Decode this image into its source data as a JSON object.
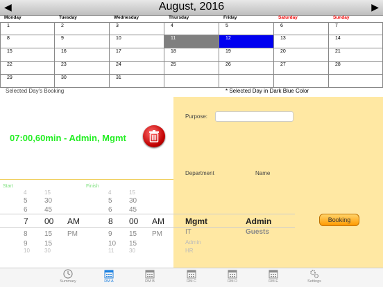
{
  "calendar": {
    "title": "August, 2016",
    "prev_arrow": "◀",
    "next_arrow": "▶",
    "weekdays": [
      "Monday",
      "Tuesday",
      "Wednesday",
      "Thursday",
      "Friday",
      "Saturday",
      "Sunday"
    ],
    "weekend_color": "#e00000",
    "weeks": [
      [
        "1",
        "2",
        "3",
        "4",
        "5",
        "6",
        "7"
      ],
      [
        "8",
        "9",
        "10",
        "11",
        "12",
        "13",
        "14"
      ],
      [
        "15",
        "16",
        "17",
        "18",
        "19",
        "20",
        "21"
      ],
      [
        "22",
        "23",
        "24",
        "25",
        "26",
        "27",
        "28"
      ],
      [
        "29",
        "30",
        "31",
        "",
        "",
        "",
        ""
      ]
    ],
    "today_day": "11",
    "selected_day": "12",
    "selected_color": "#0000f0"
  },
  "booking_list": {
    "section_label": "Selected Day's Booking",
    "note": "* Selected Day in Dark Blue Color",
    "entry": "07:00,60min - Admin, Mgmt",
    "entry_color": "#22ee22"
  },
  "pickers": {
    "start_label": "Start",
    "finish_label": "Finish",
    "start_hours": [
      "4",
      "5",
      "6",
      "7",
      "8",
      "9",
      "10"
    ],
    "start_minutes": [
      "15",
      "30",
      "45",
      "00",
      "15",
      "15",
      "30"
    ],
    "start_ampm": [
      "",
      "",
      "",
      "AM",
      "PM",
      "",
      ""
    ],
    "finish_hours": [
      "4",
      "5",
      "6",
      "8",
      "9",
      "10",
      "11"
    ],
    "finish_minutes": [
      "15",
      "30",
      "45",
      "00",
      "15",
      "15",
      "30"
    ],
    "finish_ampm": [
      "",
      "",
      "",
      "AM",
      "PM",
      "",
      ""
    ],
    "departments": [
      "Mgmt",
      "IT",
      "Admin",
      "HR"
    ],
    "names": [
      "Admin",
      "Guests"
    ]
  },
  "form": {
    "purpose_label": "Purpose:",
    "purpose_value": "",
    "department_label": "Department",
    "name_label": "Name",
    "booking_button": "Booking",
    "panel_color": "#ffe8a3"
  },
  "tabs": [
    {
      "label": "Summary",
      "icon": "clock-icon",
      "active": false
    },
    {
      "label": "RM A",
      "icon": "calendar-icon",
      "active": true
    },
    {
      "label": "RM B",
      "icon": "calendar-icon",
      "active": false
    },
    {
      "label": "RM C",
      "icon": "calendar-icon",
      "active": false
    },
    {
      "label": "RM D",
      "icon": "calendar-icon",
      "active": false
    },
    {
      "label": "RM E",
      "icon": "calendar-icon",
      "active": false
    },
    {
      "label": "Settings",
      "icon": "gear-icon",
      "active": false
    }
  ]
}
